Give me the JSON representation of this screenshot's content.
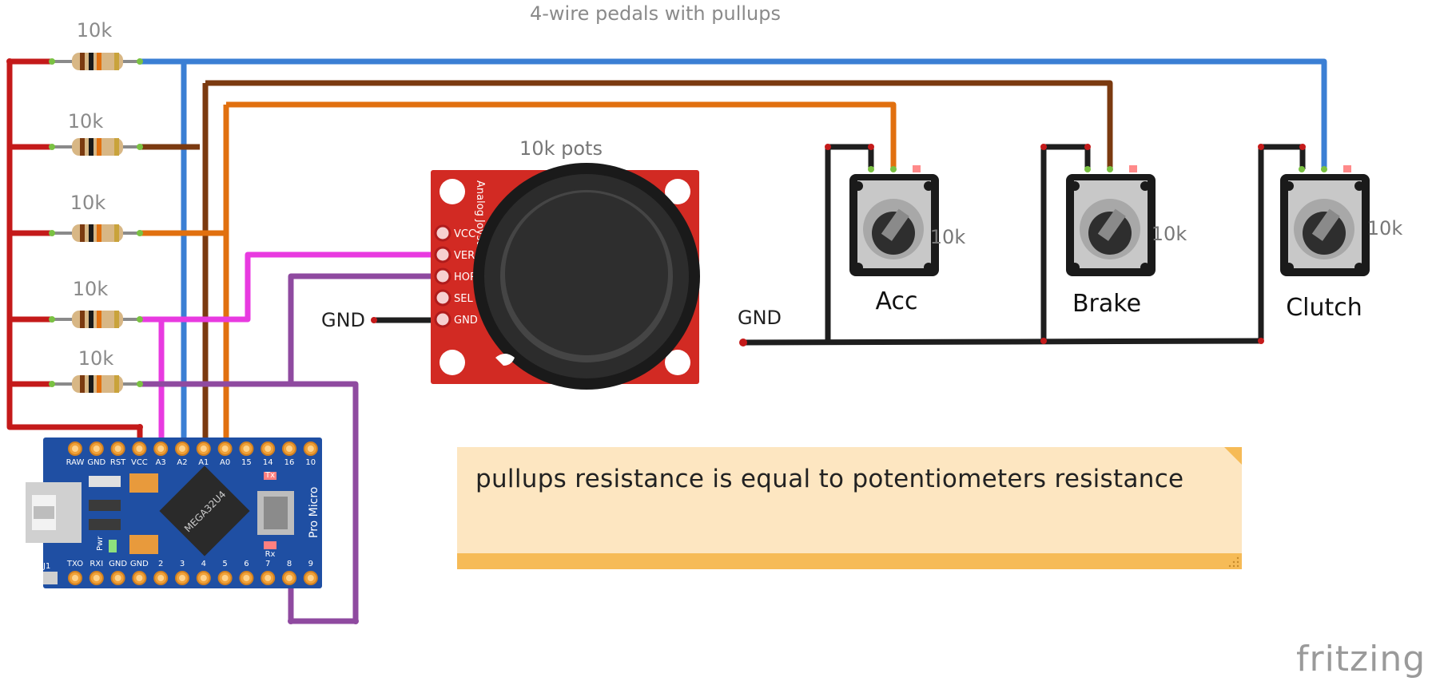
{
  "diagram_title": "4-wire pedals with pullups",
  "resistors": [
    {
      "label": "10k"
    },
    {
      "label": "10k"
    },
    {
      "label": "10k"
    },
    {
      "label": "10k"
    },
    {
      "label": "10k"
    }
  ],
  "joystick": {
    "caption": "10k pots",
    "board_text": "Analog Joystick",
    "pins": [
      "VCC",
      "VER",
      "HOR",
      "SEL",
      "GND"
    ],
    "gnd_label": "GND"
  },
  "pedals": [
    {
      "name": "Acc",
      "value": "10k"
    },
    {
      "name": "Brake",
      "value": "10k"
    },
    {
      "name": "Clutch",
      "value": "10k"
    }
  ],
  "pedal_gnd_label": "GND",
  "arduino": {
    "name": "Pro Micro",
    "chip": "MEGA32U4",
    "top_pins": [
      "RAW",
      "GND",
      "RST",
      "VCC",
      "A3",
      "A2",
      "A1",
      "A0",
      "15",
      "14",
      "16",
      "10"
    ],
    "bottom_pins": [
      "TXO",
      "RXI",
      "GND",
      "GND",
      "2",
      "3",
      "4",
      "5",
      "6",
      "7",
      "8",
      "9"
    ],
    "tx_label": "Tx",
    "rx_label": "Rx",
    "pwr_label": "Pwr",
    "j1_label": "J1"
  },
  "note": {
    "text": "pullups resistance is equal to potentiometers resistance"
  },
  "brand": "fritzing",
  "colors": {
    "red_wire": "#c41a1a",
    "blue_wire": "#3b7fd4",
    "brown_wire": "#7b3a10",
    "orange_wire": "#e1700f",
    "magenta_wire": "#e83ae0",
    "purple_wire": "#8f4aa0",
    "black_wire": "#1e1e1e",
    "board_blue": "#1f4fa3",
    "joystick_red": "#d22a23",
    "note_bg": "#fde6c1",
    "note_bar": "#f6bb57"
  }
}
